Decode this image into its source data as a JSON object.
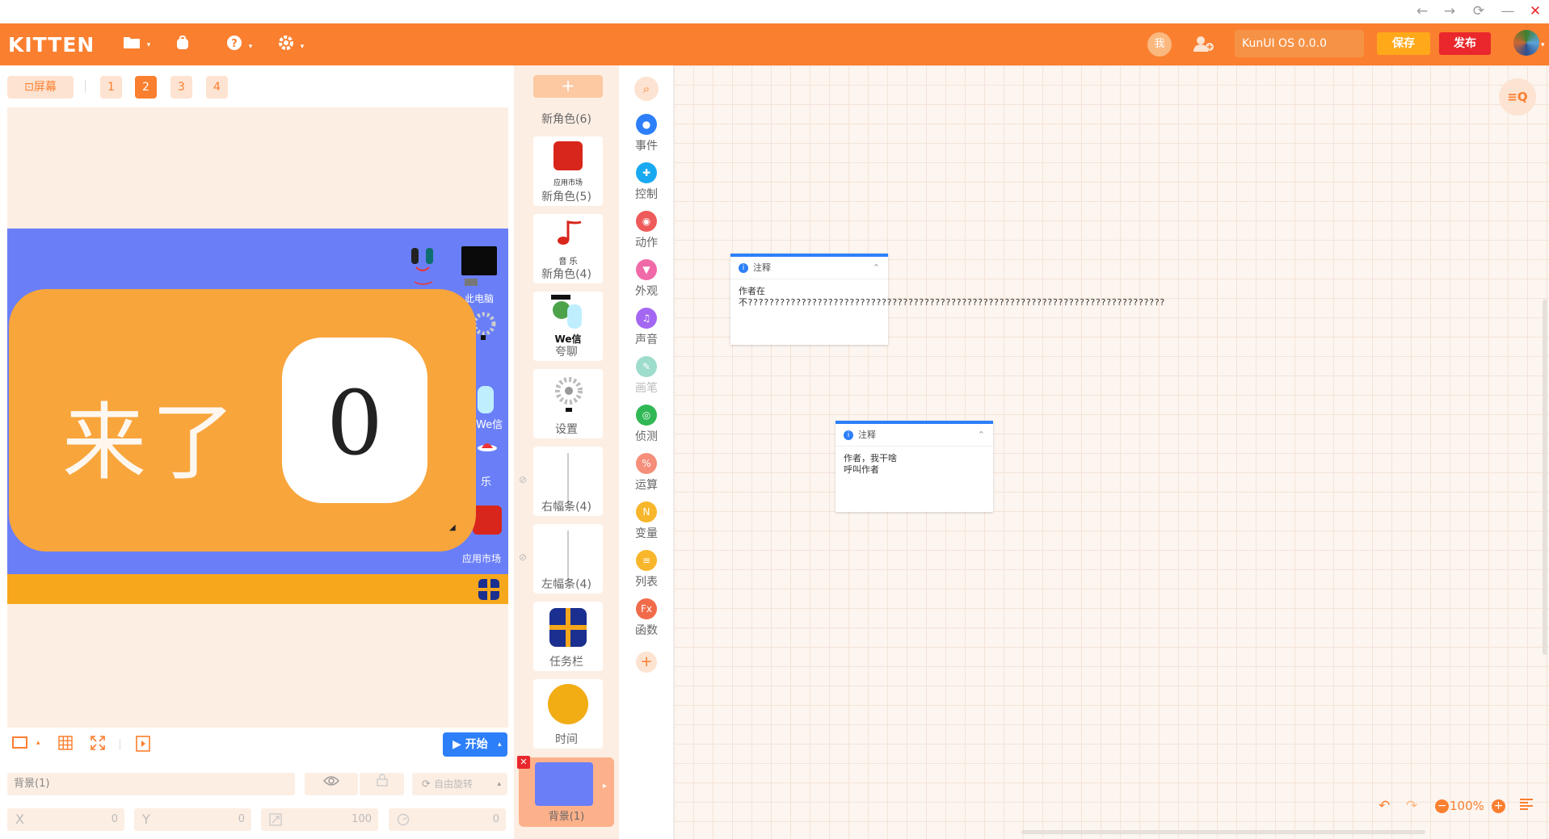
{
  "window": {
    "back": "←",
    "forward": "→",
    "reload": "⟳",
    "minimize": "—",
    "close": "✕"
  },
  "topbar": {
    "logo": "KITTEN",
    "me_label": "我",
    "os_version": "KunUI  OS 0.0.0",
    "save_label": "保存",
    "publish_label": "发布",
    "accent_color": "#fa7f2f"
  },
  "stage": {
    "screen_button": "⊡屏幕",
    "screens": [
      "1",
      "2",
      "3",
      "4"
    ],
    "active_screen": "2",
    "popup_text": "来了",
    "popup_number": "0",
    "desktop_labels": [
      "此电脑",
      "应用市场",
      "乐",
      "We信"
    ],
    "start_label": "开始"
  },
  "properties": {
    "name": "背景(1)",
    "rotate_mode": "自由旋转",
    "x_label": "X",
    "x_value": "0",
    "y_label": "Y",
    "y_value": "0",
    "size_value": "100",
    "direction_value": "0"
  },
  "sprites": {
    "add_label": "+",
    "list": [
      {
        "name": "新角色(6)"
      },
      {
        "name": "新角色(5)",
        "caption": "应用市场"
      },
      {
        "name": "新角色(4)",
        "caption": "音 乐"
      },
      {
        "name": "夸聊",
        "caption": "We信"
      },
      {
        "name": "设置"
      },
      {
        "name": "右幅条(4)"
      },
      {
        "name": "左幅条(4)"
      },
      {
        "name": "任务栏"
      },
      {
        "name": "时间"
      }
    ],
    "background": {
      "name": "背景(1)"
    }
  },
  "categories": [
    {
      "label": "事件",
      "color": "#2d7ff9"
    },
    {
      "label": "控制",
      "color": "#19a9f0"
    },
    {
      "label": "动作",
      "color": "#ef5a5a"
    },
    {
      "label": "外观",
      "color": "#f06aa8"
    },
    {
      "label": "声音",
      "color": "#a467f2"
    },
    {
      "label": "画笔",
      "color": "#9edccb"
    },
    {
      "label": "侦测",
      "color": "#31b856"
    },
    {
      "label": "运算",
      "color": "#f58e7a"
    },
    {
      "label": "变量",
      "color": "#f8b62b"
    },
    {
      "label": "列表",
      "color": "#f8b62b"
    },
    {
      "label": "函数",
      "color": "#f16b4a"
    }
  ],
  "workspace": {
    "notes": [
      {
        "title": "注释",
        "body": "作者在\n不??????????????????????????????????????????????????????????????????????????????"
      },
      {
        "title": "注释",
        "body": "作者，我干啥\n呼叫作者"
      }
    ],
    "zoom": "100%"
  }
}
